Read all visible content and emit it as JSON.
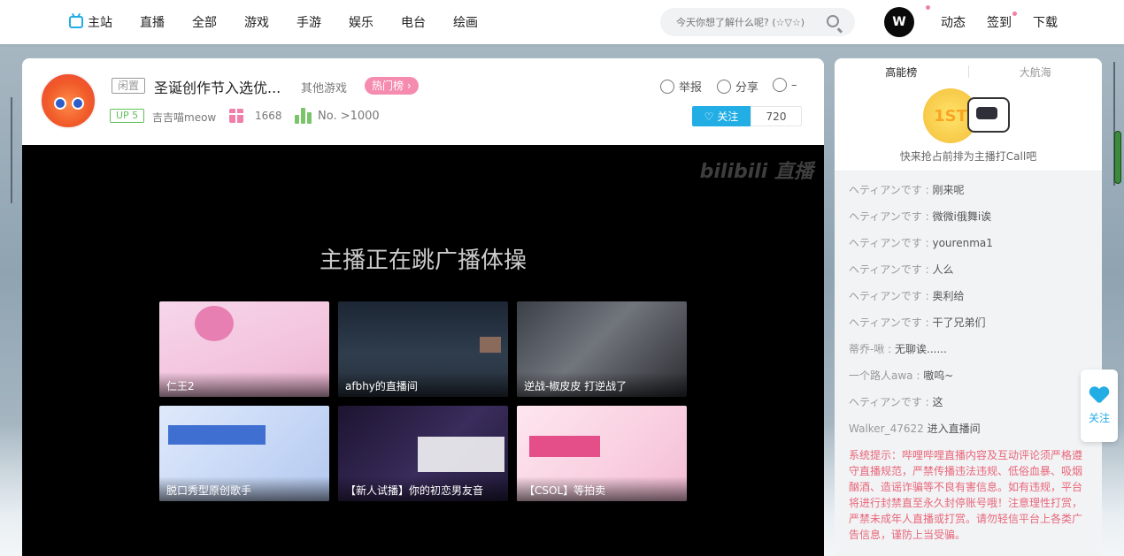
{
  "nav": {
    "items": [
      {
        "label": "主站",
        "icon": "tv-icon"
      },
      {
        "label": "直播"
      },
      {
        "label": "全部"
      },
      {
        "label": "游戏"
      },
      {
        "label": "手游"
      },
      {
        "label": "娱乐"
      },
      {
        "label": "电台"
      },
      {
        "label": "绘画"
      }
    ],
    "search_placeholder": "今天你想了解什么呢? (☆▽☆)",
    "right_items": [
      "动态",
      "签到",
      "下载"
    ]
  },
  "room": {
    "status_tag": "闲置",
    "title": "圣诞创作节入选优...",
    "area": "其他游戏",
    "hot_badge": "热门榜 ›",
    "report": "举报",
    "share": "分享",
    "viewers": "–",
    "up_level": "UP 5",
    "up_name": "吉吉喵meow",
    "gift_count": "1668",
    "rank": "No. >1000",
    "follow_label": "关注",
    "follow_count": "720"
  },
  "player": {
    "watermark": "bilibili 直播",
    "status_text": "主播正在跳广播体操",
    "recommendations": [
      {
        "label": "仁王2"
      },
      {
        "label": "afbhy的直播间"
      },
      {
        "label": "逆战-椒皮皮 打逆战了"
      },
      {
        "label": "脱口秀型原创歌手"
      },
      {
        "label": "【新人试播】你的初恋男友音"
      },
      {
        "label": "【CSOL】等拍卖"
      }
    ]
  },
  "side": {
    "tabs": [
      "高能榜",
      "大航海"
    ],
    "rank_medal": "1ST",
    "rank_caption": "快来抢占前排为主播打Call吧",
    "chat": [
      {
        "user": "ヘティアンです",
        "msg": "刚来呢"
      },
      {
        "user": "ヘティアンです",
        "msg": "微微i俄舞i诶"
      },
      {
        "user": "ヘティアンです",
        "msg": "yourenma1"
      },
      {
        "user": "ヘティアンです",
        "msg": "人么"
      },
      {
        "user": "ヘティアンです",
        "msg": "奥利给"
      },
      {
        "user": "ヘティアンです",
        "msg": "干了兄弟们"
      },
      {
        "user": "蒂乔-啾",
        "msg": "无聊诶......"
      },
      {
        "user": "一个路人awa",
        "msg": "嗷呜~"
      },
      {
        "user": "ヘティアンです",
        "msg": "这"
      },
      {
        "user": "Walker_47622",
        "msg": "进入直播间"
      }
    ],
    "system_notice": "系统提示：哔哩哔哩直播内容及互动评论须严格遵守直播规范，严禁传播违法违规、低俗血暴、吸烟酗酒、造谣诈骗等不良有害信息。如有违规，平台将进行封禁直至永久封停账号哦！注意理性打赏，严禁未成年人直播或打赏。请勿轻信平台上各类广告信息，谨防上当受骗。"
  },
  "float": {
    "follow_label": "关注"
  },
  "colors": {
    "accent": "#23ade5",
    "pink": "#f07fa9",
    "notice": "#e8677a"
  }
}
